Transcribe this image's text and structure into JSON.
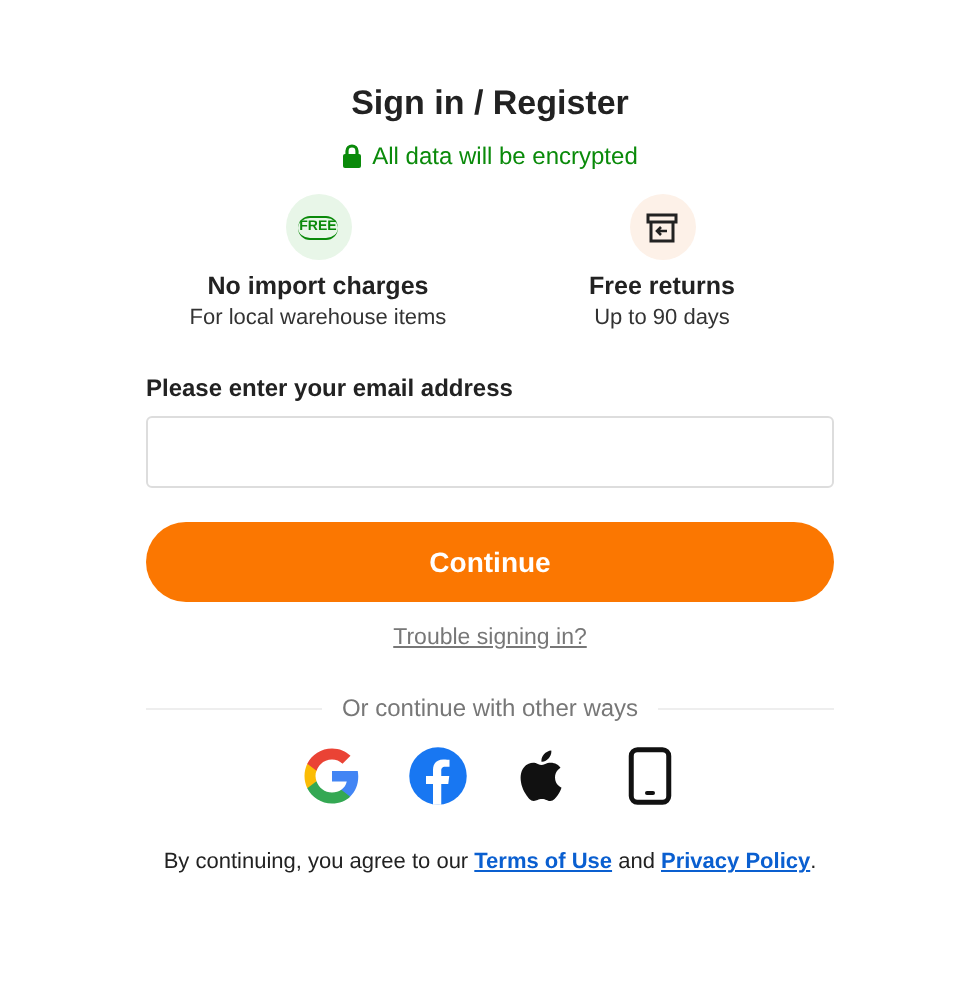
{
  "title": "Sign in / Register",
  "security_note": "All data will be encrypted",
  "features": [
    {
      "kind": "free",
      "badge": "FREE",
      "title": "No import charges",
      "subtitle": "For local warehouse items"
    },
    {
      "kind": "returns",
      "title": "Free returns",
      "subtitle": "Up to 90 days"
    }
  ],
  "email_field": {
    "label": "Please enter your email address"
  },
  "continue_button": "Continue",
  "trouble_link": "Trouble signing in?",
  "divider_text": "Or continue with other ways",
  "social_logins": [
    {
      "kind": "google"
    },
    {
      "kind": "facebook"
    },
    {
      "kind": "apple"
    },
    {
      "kind": "phone"
    }
  ],
  "consent": {
    "before": "By continuing, you agree to our ",
    "terms_link": "Terms of Use",
    "middle": " and ",
    "privacy_link": "Privacy Policy",
    "after": "."
  }
}
